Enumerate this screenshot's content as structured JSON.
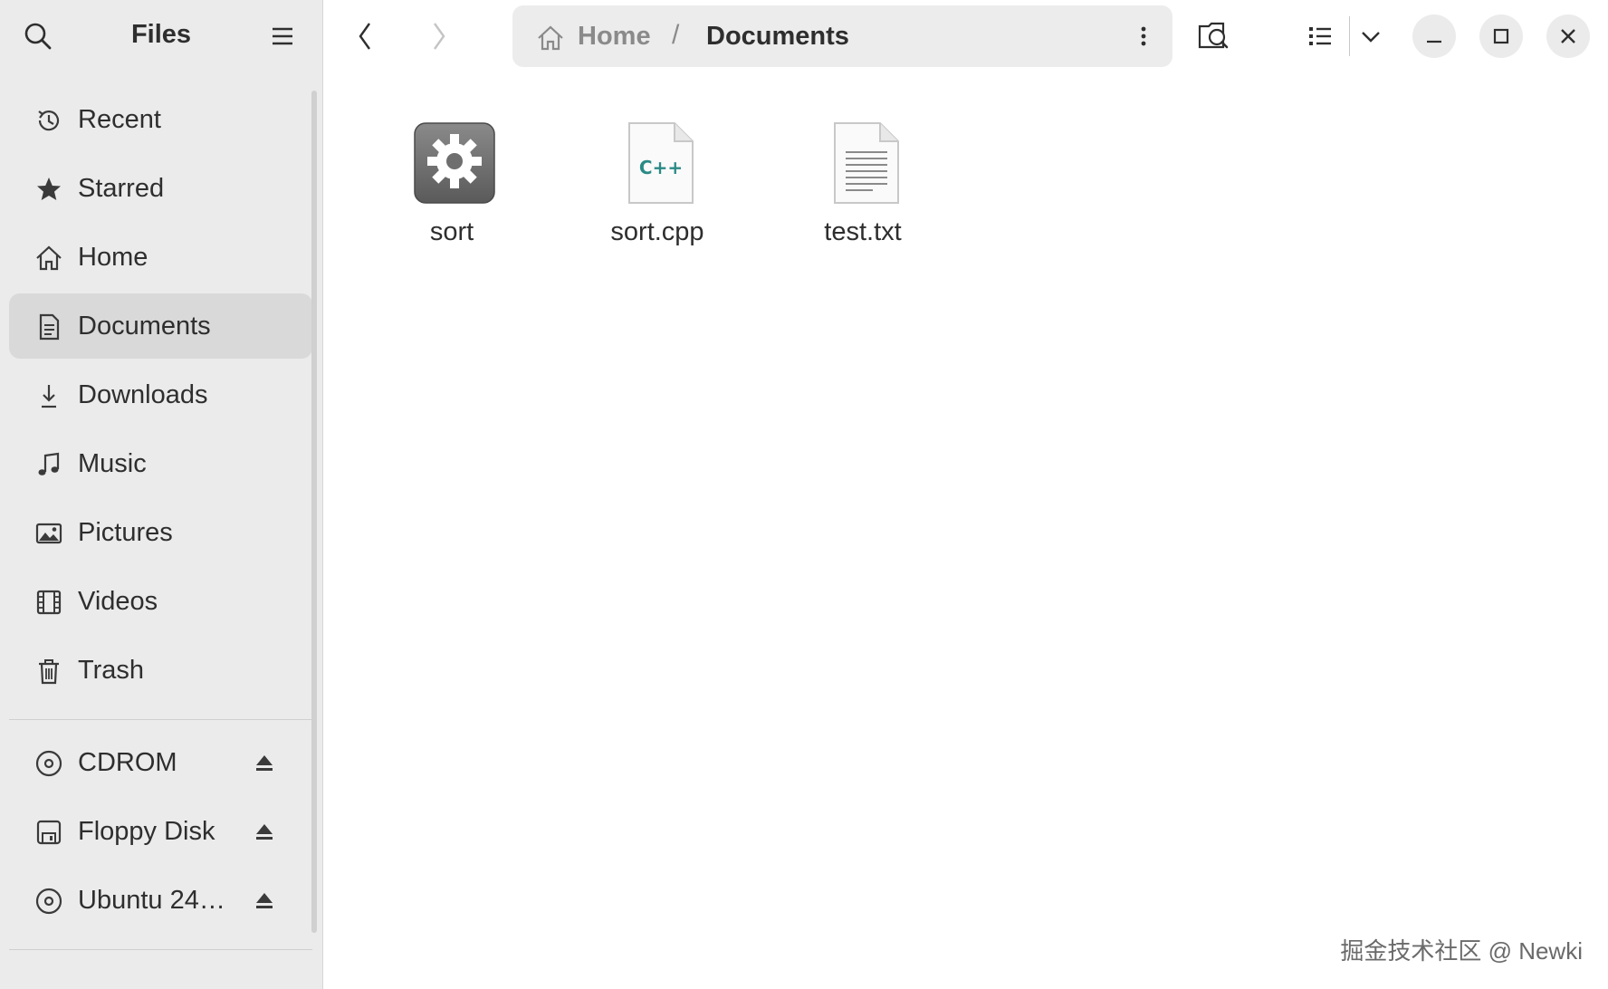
{
  "sidebar": {
    "title": "Files",
    "places": [
      {
        "label": "Recent",
        "icon": "clock-icon"
      },
      {
        "label": "Starred",
        "icon": "star-icon"
      },
      {
        "label": "Home",
        "icon": "home-icon"
      },
      {
        "label": "Documents",
        "icon": "document-icon",
        "active": true
      },
      {
        "label": "Downloads",
        "icon": "download-icon"
      },
      {
        "label": "Music",
        "icon": "music-icon"
      },
      {
        "label": "Pictures",
        "icon": "picture-icon"
      },
      {
        "label": "Videos",
        "icon": "video-icon"
      },
      {
        "label": "Trash",
        "icon": "trash-icon"
      }
    ],
    "devices": [
      {
        "label": "CDROM",
        "icon": "disc-icon"
      },
      {
        "label": "Floppy Disk",
        "icon": "floppy-icon"
      },
      {
        "label": "Ubuntu 24…",
        "icon": "disc-icon"
      }
    ]
  },
  "path": {
    "home": "Home",
    "separator": "/",
    "current": "Documents"
  },
  "files": [
    {
      "name": "sort",
      "icon": "executable-gear-icon"
    },
    {
      "name": "sort.cpp",
      "icon": "cpp-file-icon",
      "badge": "C++"
    },
    {
      "name": "test.txt",
      "icon": "text-file-icon"
    }
  ],
  "watermark": "掘金技术社区 @ Newki",
  "colors": {
    "sidebar_bg": "#ebebeb",
    "active_item_bg": "#d9d9d9",
    "pathbar_bg": "#ececec",
    "cpp_accent": "#2a8a86"
  }
}
